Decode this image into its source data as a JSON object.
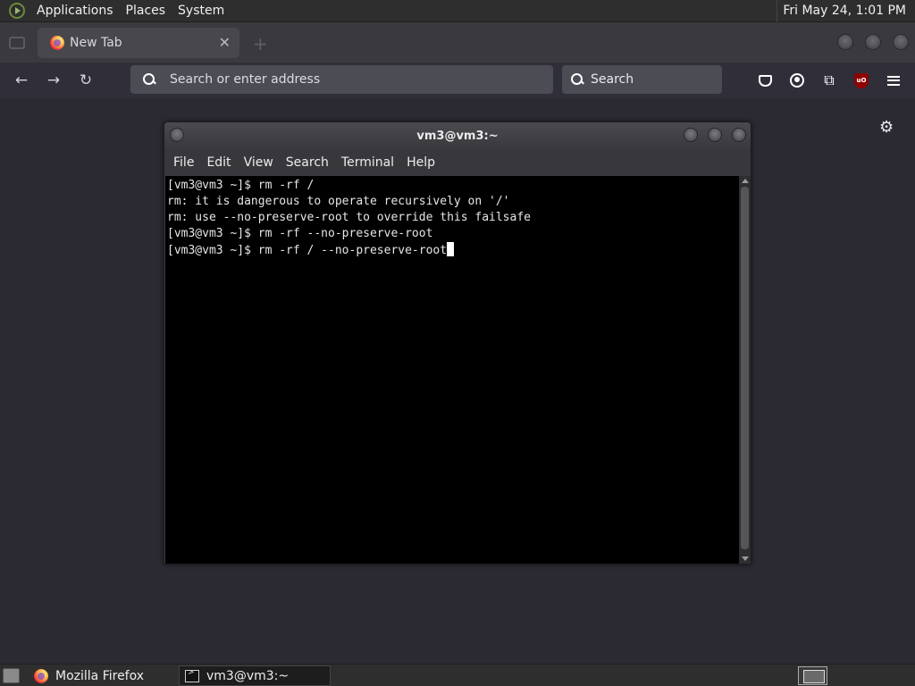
{
  "top_panel": {
    "menus": [
      "Applications",
      "Places",
      "System"
    ],
    "clock": "Fri May 24,  1:01 PM"
  },
  "browser": {
    "tab": {
      "label": "New Tab"
    },
    "url_bar": {
      "placeholder": "Search or enter address"
    },
    "search_bar": {
      "placeholder": "Search"
    },
    "icons": [
      "back-icon",
      "forward-icon",
      "reload-icon",
      "pocket-icon",
      "account-icon",
      "extensions-icon",
      "ublock-origin-icon",
      "menu-icon",
      "gear-icon"
    ]
  },
  "terminal": {
    "title": "vm3@vm3:~",
    "menus": [
      "File",
      "Edit",
      "View",
      "Search",
      "Terminal",
      "Help"
    ],
    "lines": [
      "[vm3@vm3 ~]$ rm -rf /",
      "rm: it is dangerous to operate recursively on '/'",
      "rm: use --no-preserve-root to override this failsafe",
      "[vm3@vm3 ~]$ rm -rf --no-preserve-root",
      "[vm3@vm3 ~]$ rm -rf / --no-preserve-root"
    ]
  },
  "taskbar": {
    "items": [
      {
        "label": "Mozilla Firefox"
      },
      {
        "label": "vm3@vm3:~"
      }
    ]
  }
}
